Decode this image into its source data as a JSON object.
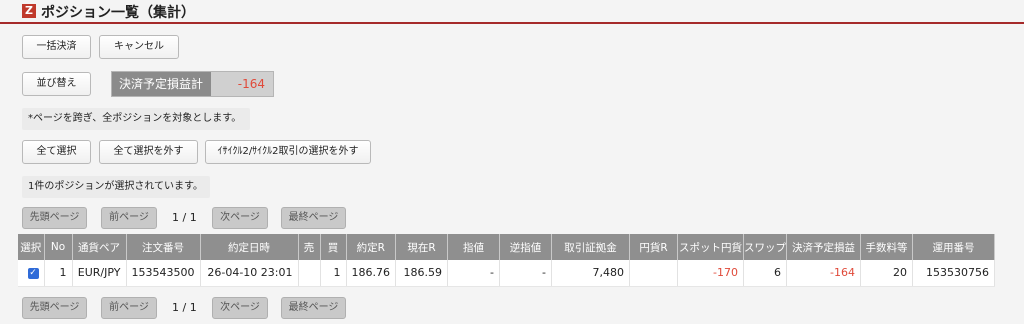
{
  "header": {
    "logo": "Z",
    "title": "ポジション一覧（集計）"
  },
  "buttons": {
    "bulk_settle": "一括決済",
    "cancel": "キャンセル",
    "sort": "並び替え",
    "select_all": "全て選択",
    "deselect_all": "全て選択を外す",
    "deselect_icycle": "ｲｻｲｸﾙ2/ｻｲｸﾙ2取引の選択を外す"
  },
  "pl_summary": {
    "label": "決済予定損益計",
    "value": "-164"
  },
  "notes": {
    "cross_page": "*ページを跨ぎ、全ポジションを対象とします。",
    "selected_count": "1件のポジションが選択されています。"
  },
  "pager": {
    "first": "先頭ページ",
    "prev": "前ページ",
    "next": "次ページ",
    "last": "最終ページ",
    "indicator": "1 / 1"
  },
  "table": {
    "headers": [
      "選択",
      "No",
      "通貨ペア",
      "注文番号",
      "約定日時",
      "売",
      "買",
      "約定R",
      "現在R",
      "指値",
      "逆指値",
      "取引証拠金",
      "円貨R",
      "スポット円貨",
      "スワップ",
      "決済予定損益",
      "手数料等",
      "運用番号"
    ],
    "rows": [
      {
        "selected": true,
        "cells": [
          "1",
          "EUR/JPY",
          "153543500",
          "26-04-10 23:01",
          "",
          "1",
          "186.76",
          "186.59",
          "-",
          "-",
          "7,480",
          "",
          "-170",
          "6",
          "-164",
          "20",
          "153530756"
        ]
      }
    ]
  },
  "colors": {
    "accent": "#a52a2a",
    "negative": "#e04a3a",
    "header_bg": "#8f8f8f"
  }
}
